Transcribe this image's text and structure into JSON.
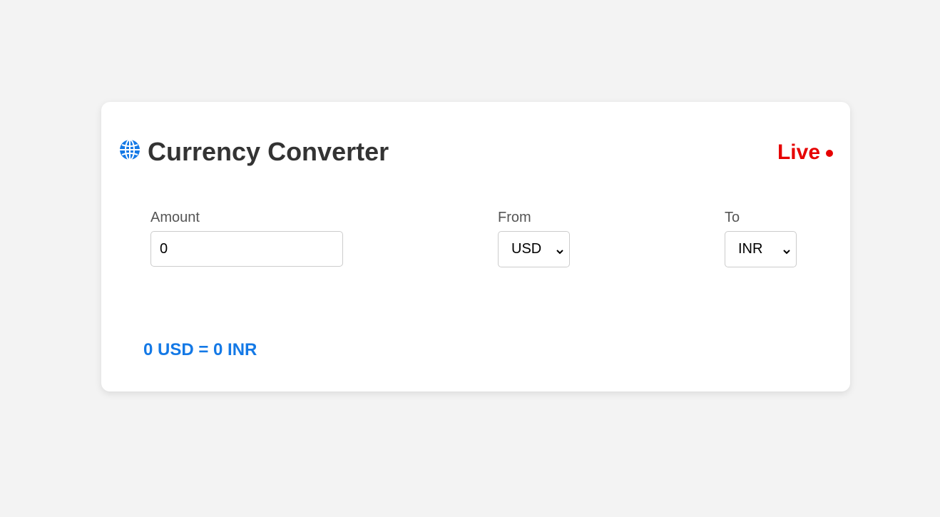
{
  "header": {
    "title": "Currency Converter",
    "live_label": "Live",
    "globe_icon": "globe-icon"
  },
  "form": {
    "amount_label": "Amount",
    "amount_value": "0",
    "from_label": "From",
    "from_selected": "USD",
    "to_label": "To",
    "to_selected": "INR"
  },
  "result": {
    "text": "0 USD = 0 INR"
  },
  "colors": {
    "accent": "#1479e6",
    "live": "#e60000",
    "title": "#333333",
    "background": "#f3f3f3"
  }
}
